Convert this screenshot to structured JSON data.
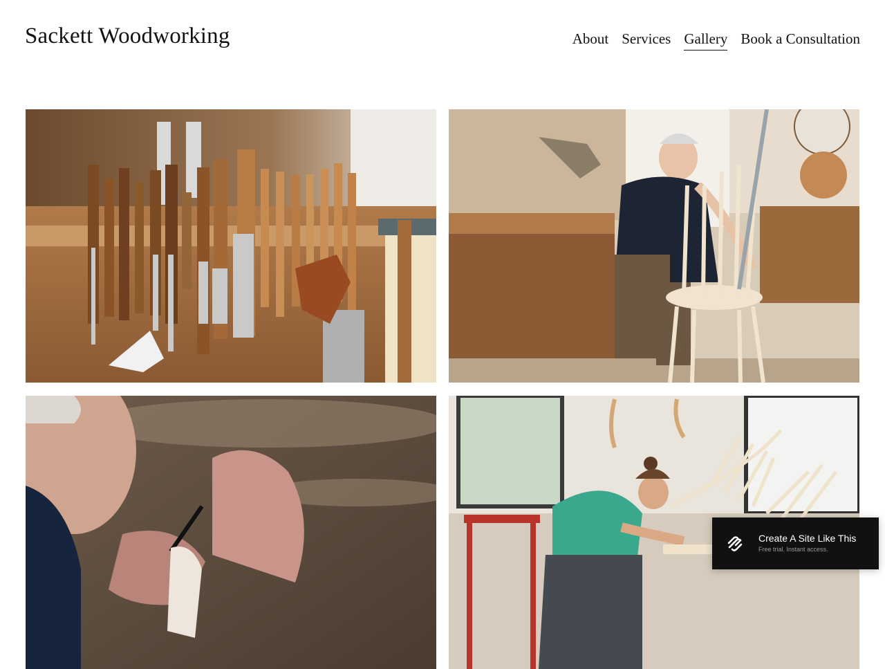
{
  "site": {
    "title": "Sackett Woodworking"
  },
  "nav": {
    "items": [
      {
        "label": "About"
      },
      {
        "label": "Services"
      },
      {
        "label": "Gallery",
        "active": true
      },
      {
        "label": "Book a Consultation"
      }
    ]
  },
  "gallery": {
    "images": [
      {
        "subject": "woodworking chisels and tools hanging on a workshop wall"
      },
      {
        "subject": "craftsman assembling a windsor chair at a workbench"
      },
      {
        "subject": "close-up of hands carving wood with a knife"
      },
      {
        "subject": "young woodworker shaping a chair spindle in a bright studio"
      }
    ]
  },
  "badge": {
    "title": "Create A Site Like This",
    "subtitle": "Free trial. Instant access."
  },
  "colors": {
    "text": "#111111",
    "background": "#ffffff",
    "badge_bg": "#111111"
  }
}
